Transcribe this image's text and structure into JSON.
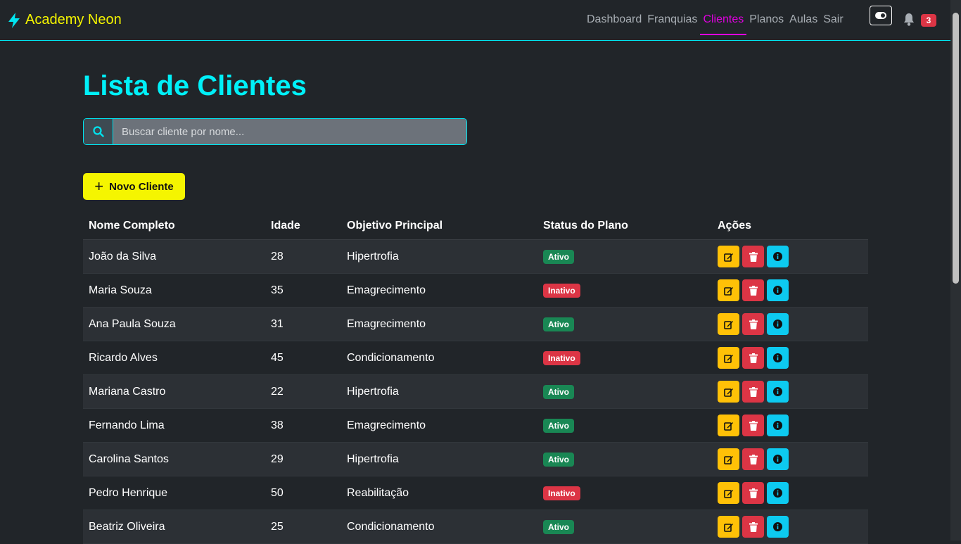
{
  "brand": {
    "name": "Academy Neon",
    "icon": "bolt-icon",
    "color": "#f5f500"
  },
  "nav": {
    "links": [
      {
        "label": "Dashboard",
        "active": false
      },
      {
        "label": "Franquias",
        "active": false
      },
      {
        "label": "Clientes",
        "active": true
      },
      {
        "label": "Planos",
        "active": false
      },
      {
        "label": "Aulas",
        "active": false
      },
      {
        "label": "Sair",
        "active": false
      }
    ],
    "notifications": "3"
  },
  "page": {
    "title": "Lista de Clientes",
    "search_placeholder": "Buscar cliente por nome...",
    "new_button": "Novo Cliente"
  },
  "table": {
    "headers": [
      "Nome Completo",
      "Idade",
      "Objetivo Principal",
      "Status do Plano",
      "Ações"
    ],
    "rows": [
      {
        "name": "João da Silva",
        "age": "28",
        "goal": "Hipertrofia",
        "status": "Ativo"
      },
      {
        "name": "Maria Souza",
        "age": "35",
        "goal": "Emagrecimento",
        "status": "Inativo"
      },
      {
        "name": "Ana Paula Souza",
        "age": "31",
        "goal": "Emagrecimento",
        "status": "Ativo"
      },
      {
        "name": "Ricardo Alves",
        "age": "45",
        "goal": "Condicionamento",
        "status": "Inativo"
      },
      {
        "name": "Mariana Castro",
        "age": "22",
        "goal": "Hipertrofia",
        "status": "Ativo"
      },
      {
        "name": "Fernando Lima",
        "age": "38",
        "goal": "Emagrecimento",
        "status": "Ativo"
      },
      {
        "name": "Carolina Santos",
        "age": "29",
        "goal": "Hipertrofia",
        "status": "Ativo"
      },
      {
        "name": "Pedro Henrique",
        "age": "50",
        "goal": "Reabilitação",
        "status": "Inativo"
      },
      {
        "name": "Beatriz Oliveira",
        "age": "25",
        "goal": "Condicionamento",
        "status": "Ativo"
      }
    ]
  },
  "colors": {
    "accent_cyan": "#00f0f8",
    "active_nav": "#e000e0",
    "ativo": "#198754",
    "inativo": "#dc3545",
    "edit": "#ffc107",
    "info": "#0dcaf0"
  }
}
